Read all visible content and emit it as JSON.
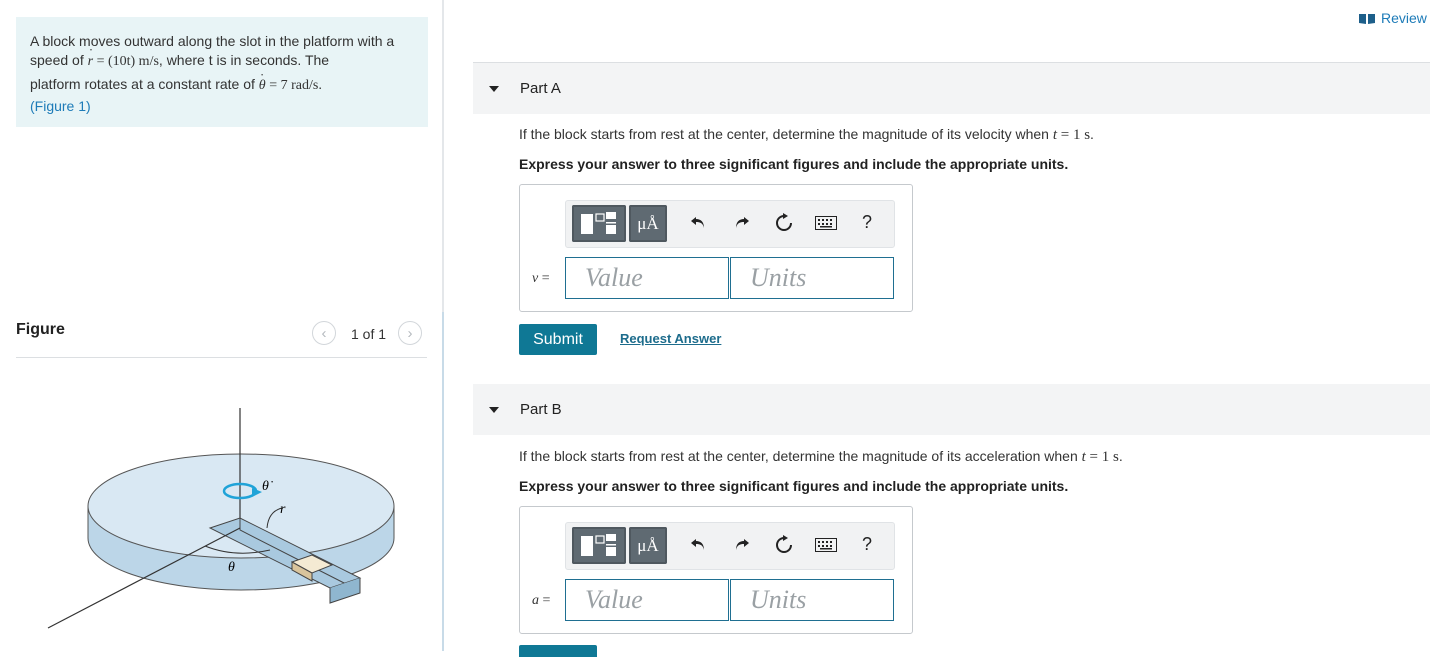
{
  "problem": {
    "line1": "A block moves outward along the slot in the platform with a",
    "line2_prefix": "speed of ",
    "r_dot_expr": "(10t) m/s",
    "line2_suffix": ", where t is in seconds. The",
    "line3_prefix": "platform rotates at a constant rate of ",
    "theta_dot_expr": "= 7 rad/s",
    "line3_suffix": ".",
    "figure_link": "(Figure 1)"
  },
  "figure": {
    "heading": "Figure",
    "counter": "1 of 1",
    "prev_icon": "chevron-left-icon",
    "next_icon": "chevron-right-icon",
    "labels": {
      "theta_dot": "θ̇",
      "r": "r",
      "theta": "θ"
    },
    "colors": {
      "platform_top": "#d9e8f3",
      "platform_side": "#bcd6e8",
      "rotation_arrow": "#1fa3d8",
      "block": "#f4ead3"
    }
  },
  "header": {
    "review": "Review",
    "review_icon": "book-icon"
  },
  "parts": [
    {
      "title": "Part A",
      "question_prefix": "If the block starts from rest at the center, determine the magnitude of its velocity when ",
      "question_math": "t = 1 s",
      "question_suffix": ".",
      "instruction": "Express your answer to three significant figures and include the appropriate units.",
      "variable": "v =",
      "value_placeholder": "Value",
      "units_placeholder": "Units",
      "submit": "Submit",
      "request": "Request Answer"
    },
    {
      "title": "Part B",
      "question_prefix": "If the block starts from rest at the center, determine the magnitude of its acceleration when ",
      "question_math": "t = 1 s",
      "question_suffix": ".",
      "instruction": "Express your answer to three significant figures and include the appropriate units.",
      "variable": "a =",
      "value_placeholder": "Value",
      "units_placeholder": "Units"
    }
  ],
  "toolbar": {
    "template_icon": "templates-icon",
    "mu_label": "μÅ",
    "undo_icon": "undo-icon",
    "redo_icon": "redo-icon",
    "reset_icon": "reset-icon",
    "keyboard_icon": "keyboard-icon",
    "help": "?"
  },
  "colors": {
    "accent": "#0f7895",
    "link": "#1d7bb8",
    "problem_bg": "#e8f4f6"
  }
}
